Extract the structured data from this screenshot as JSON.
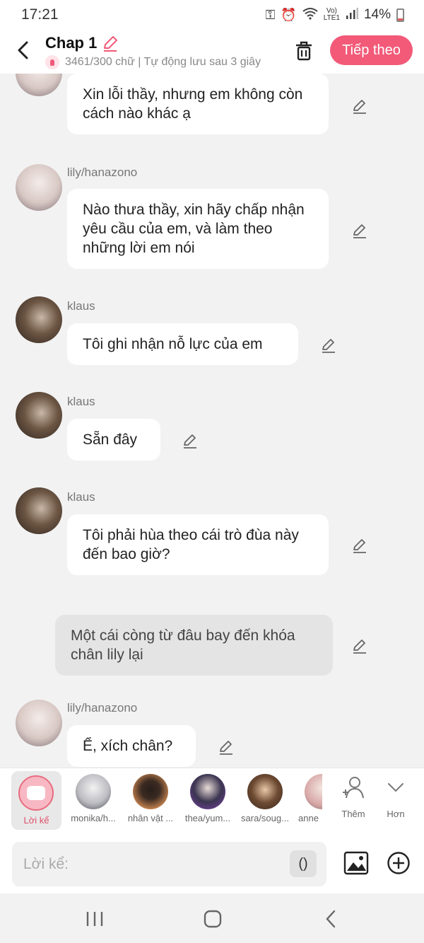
{
  "status_bar": {
    "time": "17:21",
    "battery": "14%"
  },
  "header": {
    "title": "Chap 1",
    "subtitle": "3461/300 chữ | Tự động lưu sau 3 giây",
    "next_label": "Tiếp theo"
  },
  "messages": [
    {
      "type": "character",
      "name": "",
      "text": "Xin lỗi thầy, nhưng em không còn cách nào khác ạ"
    },
    {
      "type": "character",
      "name": "lily/hanazono",
      "text": "Nào thưa thầy, xin hãy chấp nhận yêu cầu của em, và làm theo những lời em nói"
    },
    {
      "type": "character",
      "name": "klaus",
      "text": "Tôi ghi nhận nỗ lực của em"
    },
    {
      "type": "character",
      "name": "klaus",
      "text": "Sẵn đây"
    },
    {
      "type": "character",
      "name": "klaus",
      "text": "Tôi phải hùa theo cái trò đùa này đến bao giờ?"
    },
    {
      "type": "narration",
      "text": "Một cái còng từ đâu bay đến khóa chân lily lại"
    },
    {
      "type": "character",
      "name": "lily/hanazono",
      "text": "Ể, xích chân?"
    }
  ],
  "characters": {
    "narrator_label": "Lời kể",
    "items": [
      "monika/h...",
      "nhân vật ...",
      "thea/yum...",
      "sara/soug...",
      "anne"
    ],
    "add_label": "Thêm",
    "more_label": "Hơn"
  },
  "composer": {
    "placeholder": "Lời kể:",
    "paren_label": "()"
  },
  "colors": {
    "accent": "#f25a78",
    "narr_ring": "#e86d80"
  }
}
